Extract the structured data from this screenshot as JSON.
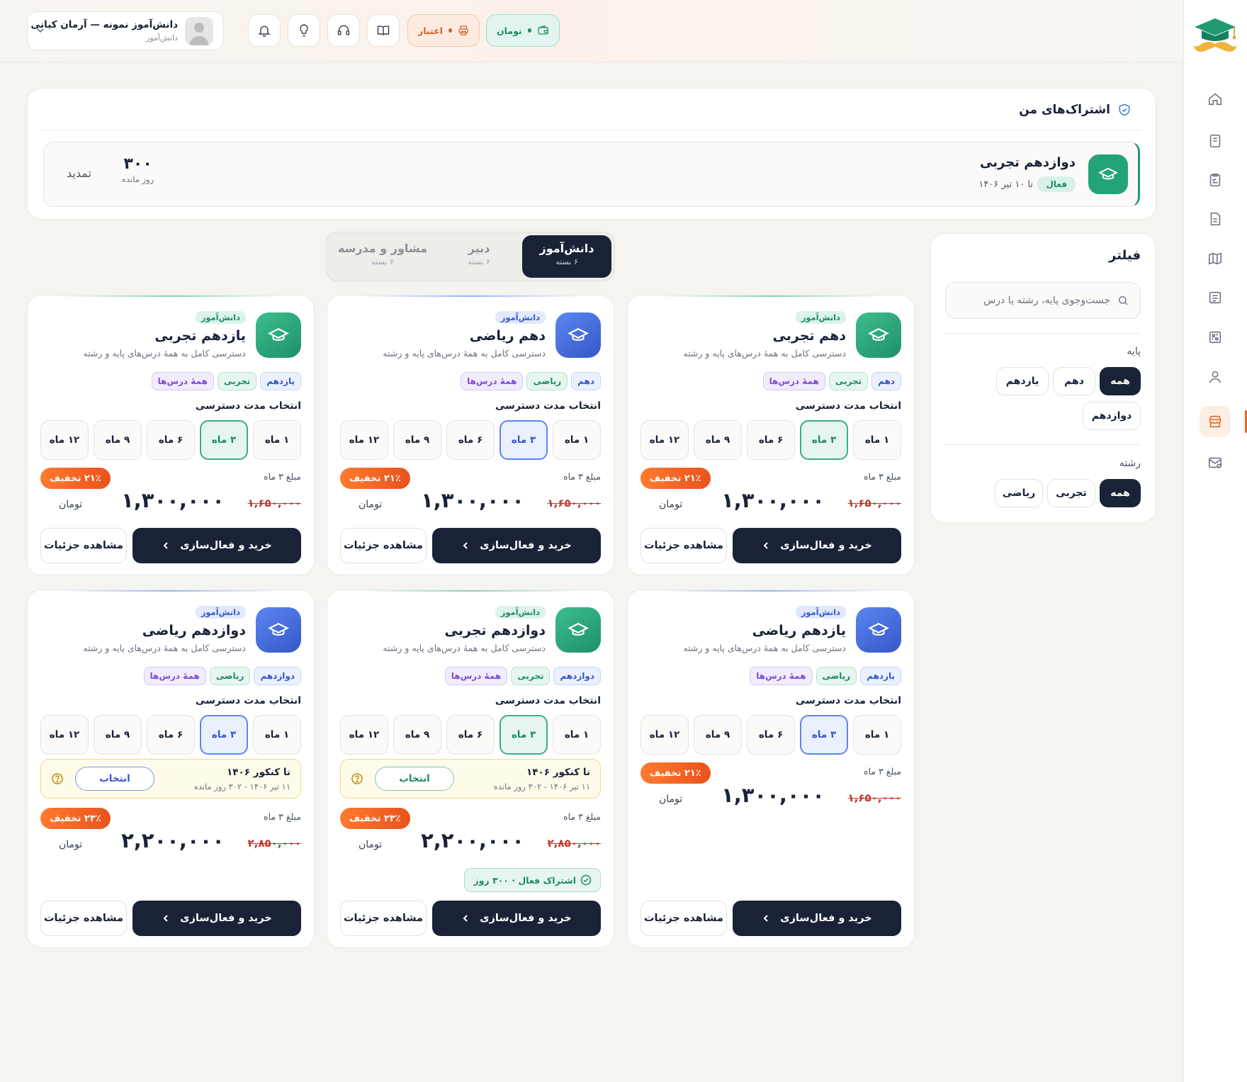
{
  "topbar": {
    "user_name": "دانش‌آموز نمونه — آرمان کیانی",
    "user_role": "دانش‌آموز",
    "credit_label": "اعتبار",
    "wallet_label": "تومان"
  },
  "subscriptions": {
    "title": "اشتراک‌های من",
    "items": [
      {
        "title": "دوازدهم تجربی",
        "status": "فعال",
        "until": "تا ۱۰ تیر ۱۴۰۶",
        "days": "۳۰۰",
        "days_label": "روز مانده",
        "renew": "تمدید"
      }
    ]
  },
  "filter": {
    "title": "فیلتر",
    "search_placeholder": "جست‌وجوی پایه، رشته یا درس",
    "grade_label": "پایه",
    "grades": [
      "همه",
      "دهم",
      "یازدهم",
      "دوازدهم"
    ],
    "field_label": "رشته",
    "fields": [
      "همه",
      "تجربی",
      "ریاضی"
    ]
  },
  "tabs": [
    {
      "title": "دانش‌آموز",
      "sub": "۶ بسته"
    },
    {
      "title": "دبیر",
      "sub": "۶ بسته"
    },
    {
      "title": "مشاور و مدرسه",
      "sub": "۶ بسته"
    }
  ],
  "common": {
    "duration_label": "انتخاب مدت دسترسی",
    "durations": [
      "۱ ماه",
      "۳ ماه",
      "۶ ماه",
      "۹ ماه",
      "۱۲ ماه"
    ],
    "price_label": "مبلغ ۳ ماه",
    "currency": "تومان",
    "buy_label": "خرید و فعال‌سازی",
    "details_label": "مشاهده جزئیات",
    "konkur_title": "تا کنکور ۱۴۰۶",
    "konkur_sub": "۱۱ تیر ۱۴۰۶ - ۳۰۲ روز مانده",
    "konkur_button": "انتخاب",
    "role_label": "دانش‌آموز",
    "description": "دسترسی کامل به همهٔ درس‌های پایه و رشته",
    "all_lessons_tag": "همهٔ درس‌ها"
  },
  "products": [
    {
      "title": "دهم تجربی",
      "grade_tag": "دهم",
      "field_tag": "تجربی",
      "discount": "۲۱٪ تخفیف",
      "old_price": "۱,۶۵۰,۰۰۰",
      "price": "۱,۳۰۰,۰۰۰"
    },
    {
      "title": "دهم ریاضی",
      "grade_tag": "دهم",
      "field_tag": "ریاضی",
      "discount": "۲۱٪ تخفیف",
      "old_price": "۱,۶۵۰,۰۰۰",
      "price": "۱,۳۰۰,۰۰۰"
    },
    {
      "title": "یازدهم تجربی",
      "grade_tag": "یازدهم",
      "field_tag": "تجربی",
      "discount": "۲۱٪ تخفیف",
      "old_price": "۱,۶۵۰,۰۰۰",
      "price": "۱,۳۰۰,۰۰۰"
    },
    {
      "title": "یازدهم ریاضی",
      "grade_tag": "یازدهم",
      "field_tag": "ریاضی",
      "discount": "۲۱٪ تخفیف",
      "old_price": "۱,۶۵۰,۰۰۰",
      "price": "۱,۳۰۰,۰۰۰"
    },
    {
      "title": "دوازدهم تجربی",
      "grade_tag": "دوازدهم",
      "field_tag": "تجربی",
      "discount": "۲۳٪ تخفیف",
      "old_price": "۲,۸۵۰,۰۰۰",
      "price": "۲,۲۰۰,۰۰۰",
      "active_note": "اشتراک فعال · ۳۰۰ روز"
    },
    {
      "title": "دوازدهم ریاضی",
      "grade_tag": "دوازدهم",
      "field_tag": "ریاضی",
      "discount": "۲۳٪ تخفیف",
      "old_price": "۲,۸۵۰,۰۰۰",
      "price": "۲,۲۰۰,۰۰۰"
    }
  ],
  "colors": {
    "navy": "#1a2238",
    "green": "#24a37a",
    "blue": "#3557c9",
    "orange": "#e8531c"
  }
}
